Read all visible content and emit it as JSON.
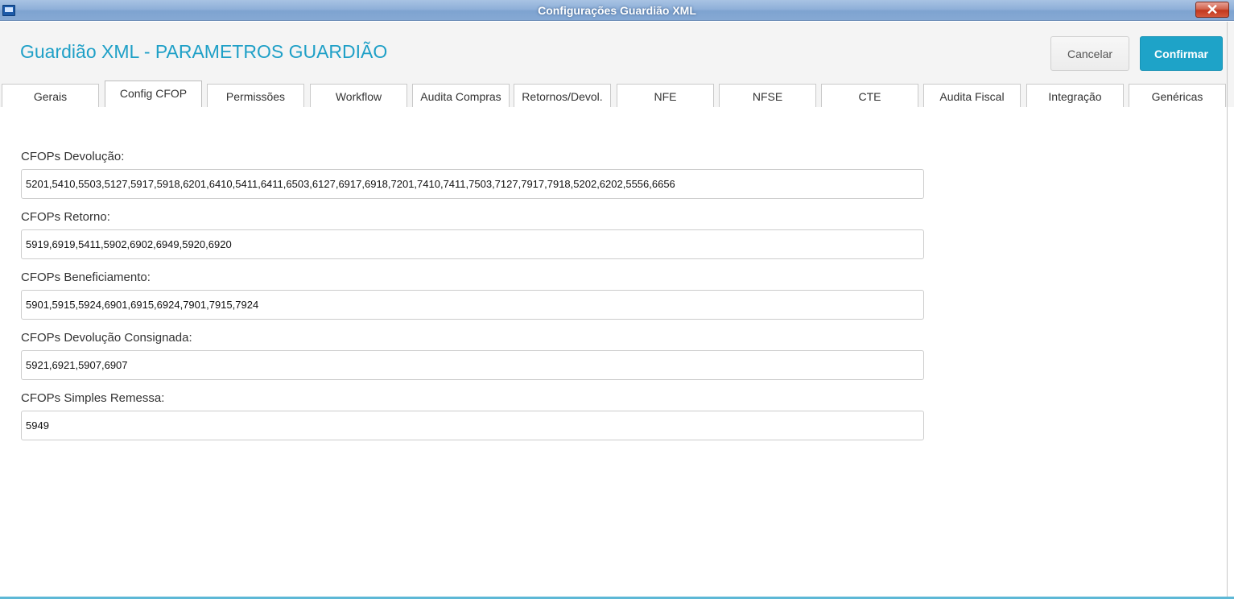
{
  "window": {
    "title": "Configurações Guardião XML",
    "close_label": "✕"
  },
  "header": {
    "title": "Guardião XML - PARAMETROS GUARDIÃO",
    "cancel_label": "Cancelar",
    "confirm_label": "Confirmar"
  },
  "tabs": [
    {
      "label": "Gerais"
    },
    {
      "label": "Config CFOP"
    },
    {
      "label": "Permissões"
    },
    {
      "label": "Workflow"
    },
    {
      "label": "Audita Compras"
    },
    {
      "label": "Retornos/Devol."
    },
    {
      "label": "NFE"
    },
    {
      "label": "NFSE"
    },
    {
      "label": "CTE"
    },
    {
      "label": "Audita Fiscal"
    },
    {
      "label": "Integração"
    },
    {
      "label": "Genéricas"
    }
  ],
  "active_tab": "Config CFOP",
  "fields": [
    {
      "label": "CFOPs Devolução:",
      "value": "5201,5410,5503,5127,5917,5918,6201,6410,5411,6411,6503,6127,6917,6918,7201,7410,7411,7503,7127,7917,7918,5202,6202,5556,6656"
    },
    {
      "label": "CFOPs Retorno:",
      "value": "5919,6919,5411,5902,6902,6949,5920,6920"
    },
    {
      "label": "CFOPs Beneficiamento:",
      "value": "5901,5915,5924,6901,6915,6924,7901,7915,7924"
    },
    {
      "label": "CFOPs Devolução Consignada:",
      "value": "5921,6921,5907,6907"
    },
    {
      "label": "CFOPs Simples Remessa:",
      "value": "5949"
    }
  ],
  "colors": {
    "accent": "#1fa0c7",
    "confirm_button": "#1ea3c8"
  }
}
